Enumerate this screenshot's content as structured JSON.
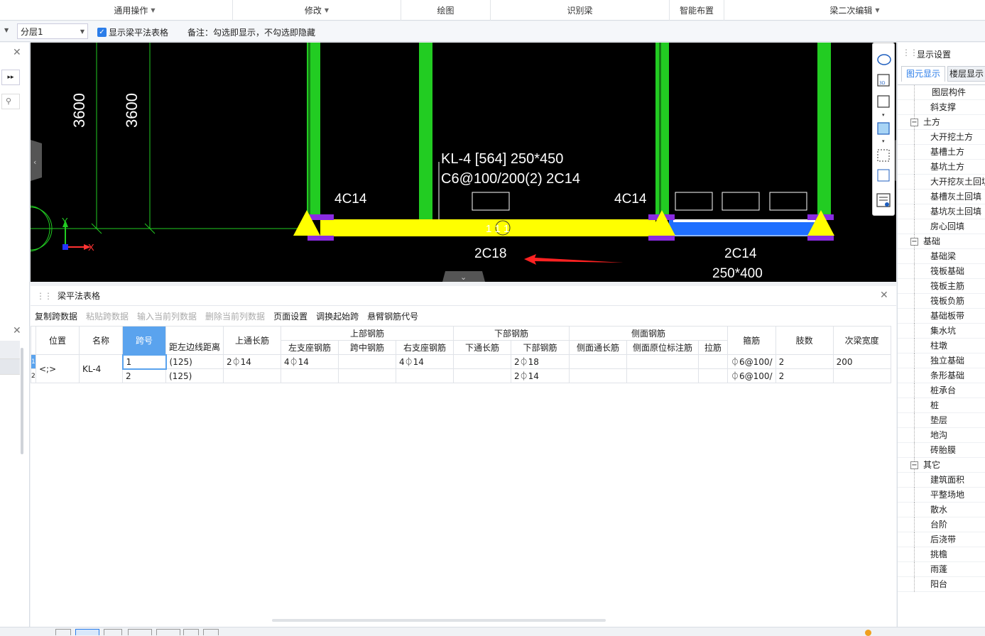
{
  "ribbon": {
    "groups": [
      {
        "label": "通用操作",
        "dropdown": true
      },
      {
        "label": "修改",
        "dropdown": true
      },
      {
        "label": "绘图",
        "dropdown": false
      },
      {
        "label": "识别梁",
        "dropdown": false
      },
      {
        "label": "智能布置",
        "dropdown": false
      },
      {
        "label": "梁二次编辑",
        "dropdown": true
      }
    ]
  },
  "toolbar2": {
    "layer": "分层1",
    "show_table_label": "显示梁平法表格",
    "show_table_checked": true,
    "note": "备注：勾选即显示，不勾选即隐藏"
  },
  "canvas": {
    "dim1": "3600",
    "dim2": "3600",
    "beam_name": "KL-4 [564] 250*450",
    "beam_spec": "C6@100/200(2) 2C14",
    "left_top_rebar": "4C14",
    "right_top_rebar": "4C14",
    "span1_bottom": "2C18",
    "span2_bottom": "2C14",
    "span2_size": "250*400",
    "span_label": "1  1  1",
    "axis_x": "X",
    "axis_y": "Y"
  },
  "table_panel": {
    "title": "梁平法表格",
    "tools": [
      {
        "label": "复制跨数据",
        "enabled": true
      },
      {
        "label": "粘贴跨数据",
        "enabled": false
      },
      {
        "label": "输入当前列数据",
        "enabled": false
      },
      {
        "label": "删除当前列数据",
        "enabled": false
      },
      {
        "label": "页面设置",
        "enabled": true
      },
      {
        "label": "调换起始跨",
        "enabled": true
      },
      {
        "label": "悬臂钢筋代号",
        "enabled": true
      }
    ],
    "header_groups": {
      "top": "上部钢筋",
      "bottom": "下部钢筋",
      "side": "侧面钢筋"
    },
    "columns": {
      "pos": "位置",
      "name": "名称",
      "span": "跨号",
      "dist": "距左边线距离",
      "top_through": "上通长筋",
      "left_support": "左支座钢筋",
      "mid": "跨中钢筋",
      "right_support": "右支座钢筋",
      "bottom_through": "下通长筋",
      "bottom": "下部钢筋",
      "side_through": "侧面通长筋",
      "side_orig": "侧面原位标注筋",
      "tie": "拉筋",
      "stirrup": "箍筋",
      "legs": "肢数",
      "sec_width": "次梁宽度"
    },
    "rows": [
      {
        "idx": "1",
        "pos": "<;>",
        "name": "KL-4",
        "span": "1",
        "dist": "(125)",
        "top_through": "2⏀14",
        "left_support": "4⏀14",
        "mid": "",
        "right_support": "4⏀14",
        "bottom_through": "",
        "bottom": "2⏀18",
        "side_through": "",
        "side_orig": "",
        "tie": "",
        "stirrup": "⏀6@100/",
        "legs": "2",
        "sec_width": "200"
      },
      {
        "idx": "2",
        "pos": "",
        "name": "",
        "span": "2",
        "dist": "(125)",
        "top_through": "",
        "left_support": "",
        "mid": "",
        "right_support": "",
        "bottom_through": "",
        "bottom": "2⏀14",
        "side_through": "",
        "side_orig": "",
        "tie": "",
        "stirrup": "⏀6@100/",
        "legs": "2",
        "sec_width": ""
      }
    ]
  },
  "right_panel": {
    "title": "显示设置",
    "tabs": [
      "图元显示",
      "楼层显示"
    ],
    "tree": [
      {
        "label": "图层构件",
        "level": 0,
        "group": false
      },
      {
        "label": "斜支撑",
        "level": 1,
        "group": false
      },
      {
        "label": "土方",
        "level": 0,
        "group": true
      },
      {
        "label": "大开挖土方",
        "level": 1,
        "group": false
      },
      {
        "label": "基槽土方",
        "level": 1,
        "group": false
      },
      {
        "label": "基坑土方",
        "level": 1,
        "group": false
      },
      {
        "label": "大开挖灰土回填",
        "level": 1,
        "group": false
      },
      {
        "label": "基槽灰土回填",
        "level": 1,
        "group": false
      },
      {
        "label": "基坑灰土回填",
        "level": 1,
        "group": false
      },
      {
        "label": "房心回填",
        "level": 1,
        "group": false
      },
      {
        "label": "基础",
        "level": 0,
        "group": true
      },
      {
        "label": "基础梁",
        "level": 1,
        "group": false
      },
      {
        "label": "筏板基础",
        "level": 1,
        "group": false
      },
      {
        "label": "筏板主筋",
        "level": 1,
        "group": false
      },
      {
        "label": "筏板负筋",
        "level": 1,
        "group": false
      },
      {
        "label": "基础板带",
        "level": 1,
        "group": false
      },
      {
        "label": "集水坑",
        "level": 1,
        "group": false
      },
      {
        "label": "柱墩",
        "level": 1,
        "group": false
      },
      {
        "label": "独立基础",
        "level": 1,
        "group": false
      },
      {
        "label": "条形基础",
        "level": 1,
        "group": false
      },
      {
        "label": "桩承台",
        "level": 1,
        "group": false
      },
      {
        "label": "桩",
        "level": 1,
        "group": false
      },
      {
        "label": "垫层",
        "level": 1,
        "group": false
      },
      {
        "label": "地沟",
        "level": 1,
        "group": false
      },
      {
        "label": "砖胎膜",
        "level": 1,
        "group": false
      },
      {
        "label": "其它",
        "level": 0,
        "group": true
      },
      {
        "label": "建筑面积",
        "level": 1,
        "group": false
      },
      {
        "label": "平整场地",
        "level": 1,
        "group": false
      },
      {
        "label": "散水",
        "level": 1,
        "group": false
      },
      {
        "label": "台阶",
        "level": 1,
        "group": false
      },
      {
        "label": "后浇带",
        "level": 1,
        "group": false
      },
      {
        "label": "挑檐",
        "level": 1,
        "group": false
      },
      {
        "label": "雨蓬",
        "level": 1,
        "group": false
      },
      {
        "label": "阳台",
        "level": 1,
        "group": false
      }
    ]
  },
  "colors": {
    "column_green": "#22cc22",
    "beam_yellow": "#ffff00",
    "beam_blue": "#1f6fff",
    "support_purple": "#8a2be2",
    "accent": "#2b7de9"
  }
}
